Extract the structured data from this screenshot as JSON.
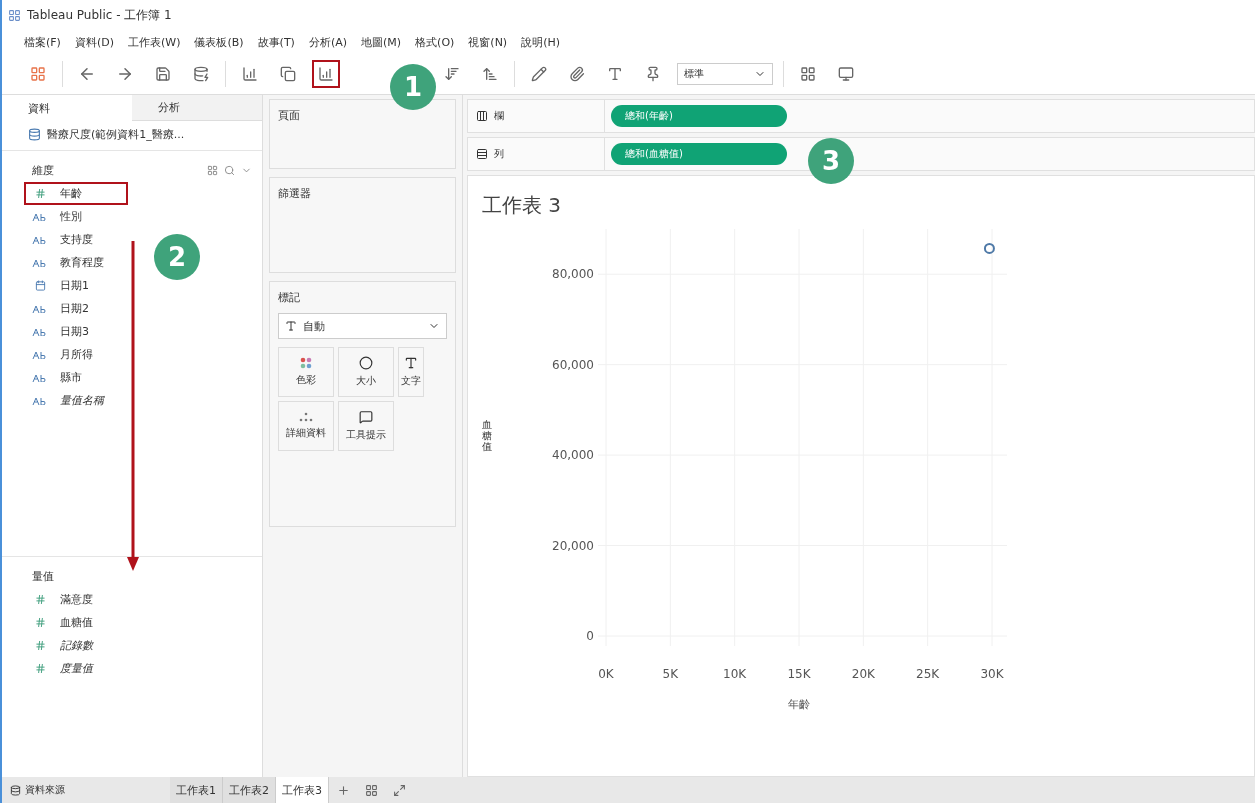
{
  "window": {
    "title": "Tableau Public - 工作簿 1"
  },
  "menu": [
    "檔案(F)",
    "資料(D)",
    "工作表(W)",
    "儀表板(B)",
    "故事(T)",
    "分析(A)",
    "地圖(M)",
    "格式(O)",
    "視窗(N)",
    "說明(H)"
  ],
  "toolbar": {
    "clear_sheet_highlighted": true,
    "mark_select": "標準"
  },
  "side_tabs": [
    {
      "label": "資料",
      "selected": true
    },
    {
      "label": "分析",
      "selected": false
    }
  ],
  "data_source": "醫療尺度(範例資料1_醫療...",
  "dimensions": {
    "title": "維度",
    "items": [
      {
        "label": "年齡",
        "kind": "number",
        "italic": false,
        "highlighted": true
      },
      {
        "label": "性別",
        "kind": "text",
        "italic": false,
        "highlighted": false
      },
      {
        "label": "支持度",
        "kind": "text",
        "italic": false,
        "highlighted": false
      },
      {
        "label": "教育程度",
        "kind": "text",
        "italic": false,
        "highlighted": false
      },
      {
        "label": "日期1",
        "kind": "date",
        "italic": false,
        "highlighted": false
      },
      {
        "label": "日期2",
        "kind": "text",
        "italic": false,
        "highlighted": false
      },
      {
        "label": "日期3",
        "kind": "text",
        "italic": false,
        "highlighted": false
      },
      {
        "label": "月所得",
        "kind": "text",
        "italic": false,
        "highlighted": false
      },
      {
        "label": "縣市",
        "kind": "text",
        "italic": false,
        "highlighted": false
      },
      {
        "label": "量值名稱",
        "kind": "text",
        "italic": true,
        "highlighted": false
      }
    ]
  },
  "measures": {
    "title": "量值",
    "items": [
      {
        "label": "滿意度",
        "kind": "number",
        "italic": false
      },
      {
        "label": "血糖值",
        "kind": "number",
        "italic": false
      },
      {
        "label": "記錄數",
        "kind": "number",
        "italic": true
      },
      {
        "label": "度量值",
        "kind": "number",
        "italic": true
      }
    ]
  },
  "cards": {
    "pages": "頁面",
    "filters": "篩選器",
    "marks": "標記",
    "mark_type": "自動",
    "buttons": [
      {
        "label": "色彩",
        "kind": "color"
      },
      {
        "label": "大小",
        "kind": "size"
      },
      {
        "label": "文字",
        "kind": "text"
      },
      {
        "label": "詳細資料",
        "kind": "detail"
      },
      {
        "label": "工具提示",
        "kind": "tooltip"
      }
    ]
  },
  "shelves": [
    {
      "label": "欄",
      "kind": "columns",
      "pill": "總和(年齡)"
    },
    {
      "label": "列",
      "kind": "rows",
      "pill": "總和(血糖值)"
    }
  ],
  "sheet": {
    "title": "工作表 3",
    "chart_data": {
      "type": "scatter",
      "grid": true,
      "xlabel": "年齡",
      "ylabel": "血糖值",
      "xlim": [
        0,
        30000
      ],
      "ylim": [
        0,
        90000
      ],
      "xticks": [
        {
          "value": 0,
          "label": "0K"
        },
        {
          "value": 5000,
          "label": "5K"
        },
        {
          "value": 10000,
          "label": "10K"
        },
        {
          "value": 15000,
          "label": "15K"
        },
        {
          "value": 20000,
          "label": "20K"
        },
        {
          "value": 25000,
          "label": "25K"
        },
        {
          "value": 30000,
          "label": "30K"
        }
      ],
      "yticks": [
        {
          "value": 0,
          "label": "0"
        },
        {
          "value": 20000,
          "label": "20,000"
        },
        {
          "value": 40000,
          "label": "40,000"
        },
        {
          "value": 60000,
          "label": "60,000"
        },
        {
          "value": 80000,
          "label": "80,000"
        }
      ],
      "x": [
        29800
      ],
      "series": [
        {
          "color": "#4e79a7",
          "values": [
            85700
          ]
        }
      ]
    }
  },
  "bottom_tabs": {
    "data_source": "資料來源",
    "sheets": [
      {
        "label": "工作表1",
        "selected": false
      },
      {
        "label": "工作表2",
        "selected": false
      },
      {
        "label": "工作表3",
        "selected": true
      }
    ]
  },
  "callouts": [
    "1",
    "2",
    "3"
  ]
}
